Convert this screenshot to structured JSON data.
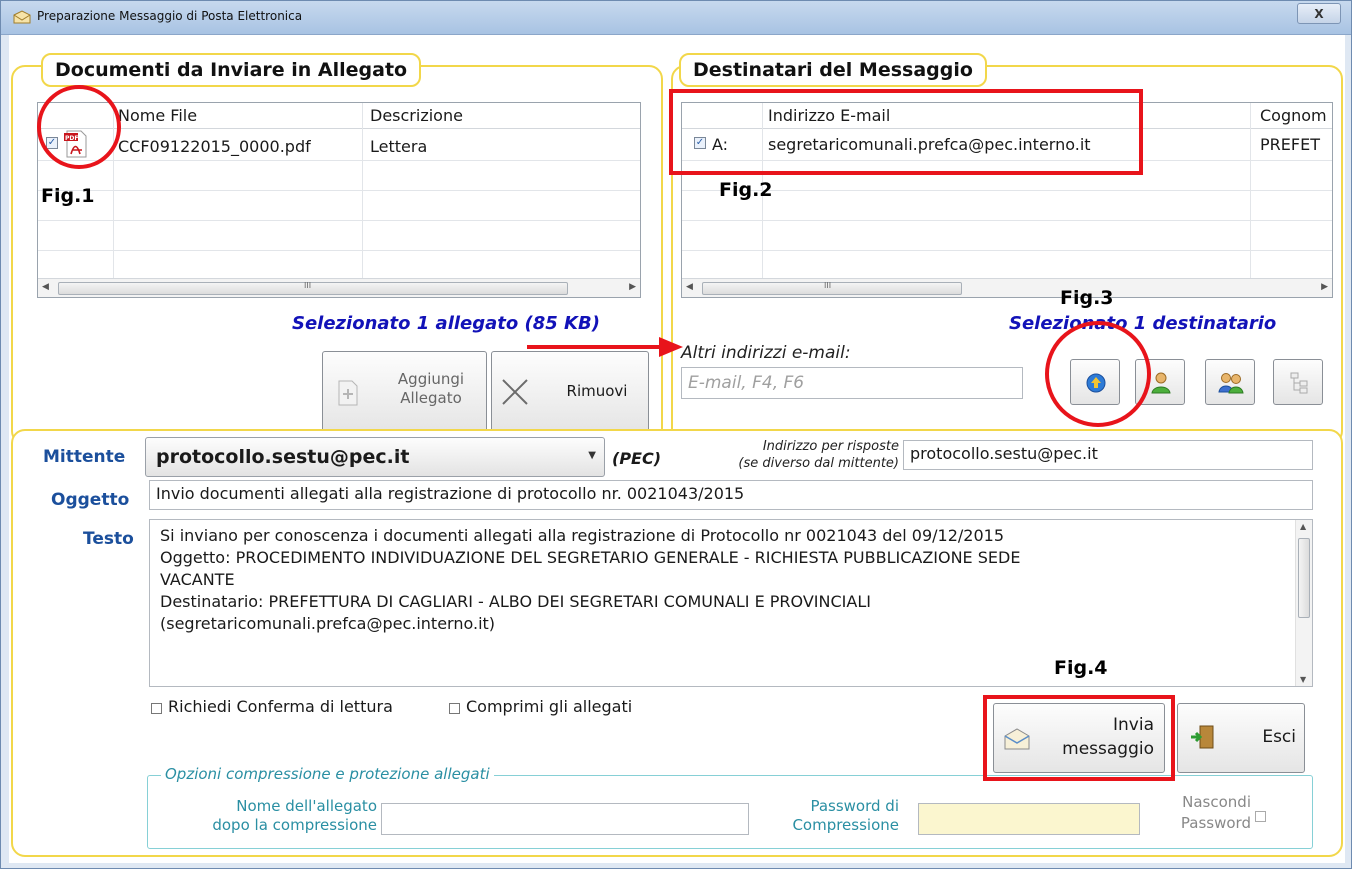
{
  "window": {
    "title": "Preparazione Messaggio di Posta Elettronica",
    "close_label": "X"
  },
  "attachments": {
    "title": "Documenti da Inviare in Allegato",
    "columns": [
      "Nome File",
      "Descrizione"
    ],
    "rows": [
      {
        "file": "CCF09122015_0000.pdf",
        "description": "Lettera",
        "checked": true,
        "icon": "pdf-icon"
      }
    ],
    "scroll_mark": "III",
    "status": "Selezionato 1 allegato (85 KB)",
    "add_label_1": "Aggiungi",
    "add_label_2": "Allegato",
    "remove_label": "Rimuovi"
  },
  "recipients": {
    "title": "Destinatari del Messaggio",
    "columns": [
      "Indirizzo E-mail",
      "Cognom"
    ],
    "rows": [
      {
        "type": "A:",
        "email": "segretaricomunali.prefca@pec.interno.it",
        "surname": "PREFET",
        "checked": true
      }
    ],
    "scroll_mark": "III",
    "status": "Selezionato 1 destinatario",
    "other_label": "Altri indirizzi e-mail:",
    "other_placeholder": "E-mail, F4, F6"
  },
  "annotations": {
    "fig1": "Fig.1",
    "fig2": "Fig.2",
    "fig3": "Fig.3",
    "fig4": "Fig.4",
    "accent": "#e8141b"
  },
  "message": {
    "sender_label": "Mittente",
    "sender_value": "protocollo.sestu@pec.it",
    "pec_label": "(PEC)",
    "reply_label_1": "Indirizzo per risposte",
    "reply_label_2": "(se diverso dal mittente)",
    "reply_value": "protocollo.sestu@pec.it",
    "subject_label": "Oggetto",
    "subject_value": "Invio documenti allegati alla registrazione di protocollo nr. 0021043/2015",
    "body_label": "Testo",
    "body_lines": [
      "Si inviano per conoscenza i documenti allegati alla registrazione di Protocollo nr 0021043 del 09/12/2015",
      "Oggetto: PROCEDIMENTO INDIVIDUAZIONE DEL SEGRETARIO GENERALE - RICHIESTA PUBBLICAZIONE SEDE",
      "VACANTE",
      "Destinatario: PREFETTURA DI CAGLIARI - ALBO DEI SEGRETARI COMUNALI E PROVINCIALI",
      "(segretaricomunali.prefca@pec.interno.it)"
    ],
    "read_receipt_label": "Richiedi Conferma di lettura",
    "compress_label": "Comprimi gli allegati",
    "send_label_1": "Invia",
    "send_label_2": "messaggio",
    "exit_label": "Esci"
  },
  "compression": {
    "title": "Opzioni compressione e protezione allegati",
    "name_label_1": "Nome dell'allegato",
    "name_label_2": "dopo la compressione",
    "password_label_1": "Password di",
    "password_label_2": "Compressione",
    "hide_label_1": "Nascondi",
    "hide_label_2": "Password",
    "password_field_color": "#fbf6cf"
  }
}
